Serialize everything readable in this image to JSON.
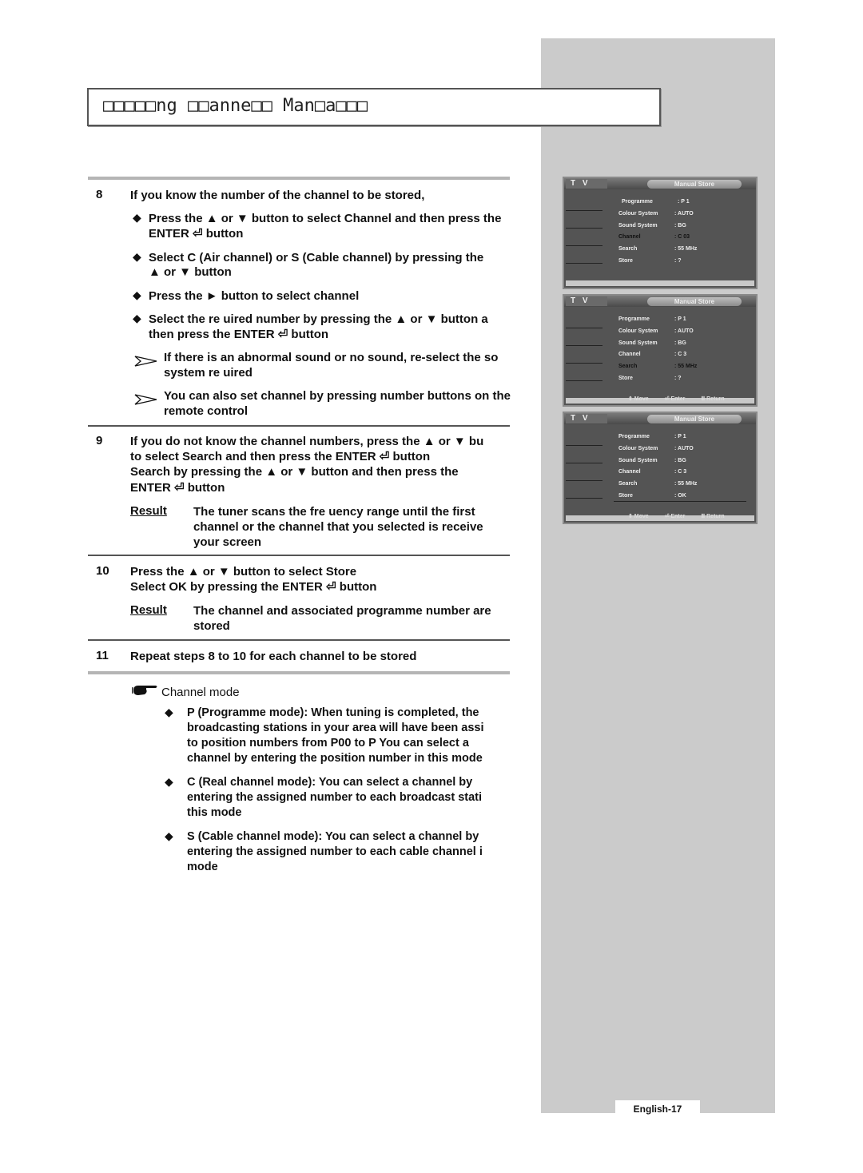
{
  "page": {
    "title": "□□□□□ng □□anne□□ Man□a□□□",
    "page_number": "English-17"
  },
  "steps": {
    "s8": {
      "num": "8",
      "heading": "If you know the number of the channel to be stored,",
      "b1_l1": "Press the ▲ or ▼ button to select Channel and then press the",
      "b1_l2": "ENTER ⏎ button",
      "b2_l1": "Select C (Air channel) or S (Cable channel) by pressing the",
      "b2_l2": "▲ or ▼ button",
      "b3_l1": "Press the ► button to select channel",
      "b4_l1": "Select the re uired number by pressing the ▲ or ▼ button a",
      "b4_l2": "then press the ENTER ⏎ button",
      "n1_l1": "If there is an abnormal sound or no sound, re-select the so",
      "n1_l2": "system re uired",
      "n2_l1": "You can also set channel by pressing number buttons on the",
      "n2_l2": "remote control"
    },
    "s9": {
      "num": "9",
      "l1": "If you do not know the channel numbers, press the ▲ or ▼ bu",
      "l2": "to select Search and then press the ENTER ⏎ button",
      "l3": "Search by pressing the ▲ or ▼ button and then press the",
      "l4": "ENTER ⏎ button",
      "result_label": "Result",
      "r1": "The tuner scans the fre uency range until the first",
      "r2": "channel or the channel that you selected is receive",
      "r3": "your screen"
    },
    "s10": {
      "num": "10",
      "l1": "Press the ▲ or ▼ button to select Store",
      "l2": "Select OK by pressing the ENTER ⏎ button",
      "result_label": "Result",
      "r1": "The channel and associated programme number are",
      "r2": "stored"
    },
    "s11": {
      "num": "11",
      "l1": "Repeat steps 8 to 10 for each channel to be stored"
    }
  },
  "channel_mode": {
    "heading": "Channel mode",
    "p": {
      "l1": "P (Programme mode): When tuning is completed, the",
      "l2": "broadcasting stations in your area will have been assi",
      "l3": "to position numbers from P00 to P    You can select a",
      "l4": "channel by entering the position number in this mode"
    },
    "c": {
      "l1": "C (Real channel mode): You can select a channel by",
      "l2": "entering the assigned number to each broadcast stati",
      "l3": "this mode"
    },
    "s": {
      "l1": "S (Cable channel mode): You can select a channel by",
      "l2": "entering the assigned number to each cable channel i",
      "l3": "mode"
    }
  },
  "tv_screens": [
    {
      "label": "T V",
      "title": "Manual Store",
      "rows": [
        {
          "key": "Programme",
          "value": ": P    1"
        },
        {
          "key": "Colour System",
          "value": ": AUTO"
        },
        {
          "key": "Sound System",
          "value": ": BG"
        },
        {
          "key": "Channel",
          "value": ": C    03"
        },
        {
          "key": "Search",
          "value": ": 55    MHz"
        },
        {
          "key": "Store",
          "value": ": ?"
        }
      ],
      "active_row": "Channel",
      "footer": {
        "move": "",
        "enter": "",
        "return": ""
      }
    },
    {
      "label": "T V",
      "title": "Manual Store",
      "rows": [
        {
          "key": "Programme",
          "value": ": P    1"
        },
        {
          "key": "Colour System",
          "value": ": AUTO"
        },
        {
          "key": "Sound System",
          "value": ": BG"
        },
        {
          "key": "Channel",
          "value": ": C    3"
        },
        {
          "key": "Search",
          "value": ": 55    MHz"
        },
        {
          "key": "Store",
          "value": ": ?"
        }
      ],
      "active_row": "Search",
      "footer": {
        "move": "⇕ Move",
        "enter": "⏎ Enter",
        "return": "Ⅲ Return"
      }
    },
    {
      "label": "T V",
      "title": "Manual Store",
      "rows": [
        {
          "key": "Programme",
          "value": ": P    1"
        },
        {
          "key": "Colour System",
          "value": ": AUTO"
        },
        {
          "key": "Sound System",
          "value": ": BG"
        },
        {
          "key": "Channel",
          "value": ": C    3"
        },
        {
          "key": "Search",
          "value": ": 55    MHz"
        },
        {
          "key": "Store",
          "value": ": OK"
        }
      ],
      "active_row": "Store",
      "footer": {
        "move": "⇕ Move",
        "enter": "⏎ Enter",
        "return": "Ⅲ Return"
      }
    }
  ]
}
